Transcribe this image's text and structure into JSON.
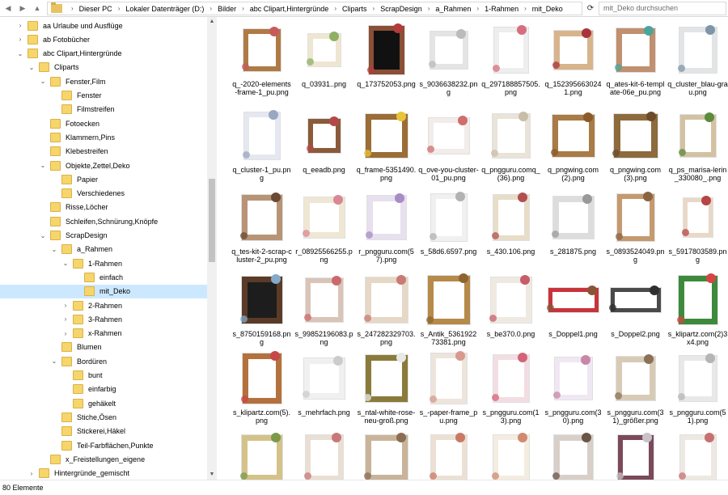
{
  "address": {
    "crumbs": [
      "Dieser PC",
      "Lokaler Datenträger (D:)",
      "Bilder",
      "abc Clipart,Hintergründe",
      "Cliparts",
      "ScrapDesign",
      "a_Rahmen",
      "1-Rahmen",
      "mit_Deko"
    ],
    "search_placeholder": "mit_Deko durchsuchen"
  },
  "tree": [
    {
      "label": "aa Urlaube und Ausflüge",
      "level": 0,
      "expand": "collapsed"
    },
    {
      "label": "ab Fotobücher",
      "level": 0,
      "expand": "collapsed"
    },
    {
      "label": "abc Clipart,Hintergründe",
      "level": 0,
      "expand": "expanded"
    },
    {
      "label": "Cliparts",
      "level": 1,
      "expand": "expanded"
    },
    {
      "label": "Fenster,Film",
      "level": 2,
      "expand": "expanded"
    },
    {
      "label": "Fenster",
      "level": 3,
      "expand": "none"
    },
    {
      "label": "Filmstreifen",
      "level": 3,
      "expand": "none"
    },
    {
      "label": "Fotoecken",
      "level": 2,
      "expand": "none"
    },
    {
      "label": "Klammern,Pins",
      "level": 2,
      "expand": "none"
    },
    {
      "label": "Klebestreifen",
      "level": 2,
      "expand": "none"
    },
    {
      "label": "Objekte,Zettel,Deko",
      "level": 2,
      "expand": "expanded"
    },
    {
      "label": "Papier",
      "level": 3,
      "expand": "none"
    },
    {
      "label": "Verschiedenes",
      "level": 3,
      "expand": "none"
    },
    {
      "label": "Risse,Löcher",
      "level": 2,
      "expand": "none"
    },
    {
      "label": "Schleifen,Schnürung,Knöpfe",
      "level": 2,
      "expand": "none"
    },
    {
      "label": "ScrapDesign",
      "level": 2,
      "expand": "expanded"
    },
    {
      "label": "a_Rahmen",
      "level": 3,
      "expand": "expanded"
    },
    {
      "label": "1-Rahmen",
      "level": 4,
      "expand": "expanded"
    },
    {
      "label": "einfach",
      "level": 5,
      "expand": "none"
    },
    {
      "label": "mit_Deko",
      "level": 5,
      "expand": "none",
      "selected": true
    },
    {
      "label": "2-Rahmen",
      "level": 4,
      "expand": "collapsed"
    },
    {
      "label": "3-Rahmen",
      "level": 4,
      "expand": "collapsed"
    },
    {
      "label": "x-Rahmen",
      "level": 4,
      "expand": "collapsed"
    },
    {
      "label": "Blumen",
      "level": 3,
      "expand": "none"
    },
    {
      "label": "Bordüren",
      "level": 3,
      "expand": "expanded"
    },
    {
      "label": "bunt",
      "level": 4,
      "expand": "none"
    },
    {
      "label": "einfarbig",
      "level": 4,
      "expand": "none"
    },
    {
      "label": "gehäkelt",
      "level": 4,
      "expand": "none"
    },
    {
      "label": "Stiche,Ösen",
      "level": 3,
      "expand": "none"
    },
    {
      "label": "Stickerei,Häkel",
      "level": 3,
      "expand": "none"
    },
    {
      "label": "Teil-Farbflächen,Punkte",
      "level": 3,
      "expand": "none"
    },
    {
      "label": "x_Freistellungen_eigene",
      "level": 2,
      "expand": "none"
    },
    {
      "label": "Hintergründe_gemischt",
      "level": 1,
      "expand": "collapsed"
    }
  ],
  "files": [
    {
      "name": "q_-2020-elements-frame-1_pu.png",
      "frame": "#b07a45",
      "deco": "#c75b5b",
      "w": 46,
      "h": 52,
      "bg": "#ffffff"
    },
    {
      "name": "q_03931..png",
      "frame": "#efe6d2",
      "deco": "#8fb062",
      "w": 40,
      "h": 40,
      "bg": "#ffffff"
    },
    {
      "name": "q_173752053.png",
      "frame": "#8a4f36",
      "deco": "#b43b3b",
      "w": 44,
      "h": 60,
      "bg": "#111111"
    },
    {
      "name": "s_9036638232.png",
      "frame": "#e4e4e4",
      "deco": "#bbbbbb",
      "w": 46,
      "h": 46,
      "bg": "#ffffff"
    },
    {
      "name": "q_297188857505.png",
      "frame": "#eeeeee",
      "deco": "#d56f7d",
      "w": 42,
      "h": 56,
      "bg": "#ffffff"
    },
    {
      "name": "q_1523956630241.png",
      "frame": "#d8b48c",
      "deco": "#a8333b",
      "w": 48,
      "h": 48,
      "bg": "#ffffff"
    },
    {
      "name": "q_ates-kit-6-template-06e_pu.png",
      "frame": "#c09070",
      "deco": "#4aa59c",
      "w": 48,
      "h": 54,
      "bg": "#ffffff"
    },
    {
      "name": "q_cluster_blau-grau.png",
      "frame": "#e2e4e6",
      "deco": "#7f95a8",
      "w": 46,
      "h": 56,
      "bg": "#ffffff"
    },
    {
      "name": "q_cluster-1_pu.png",
      "frame": "#e5e8f0",
      "deco": "#9aa7c0",
      "w": 44,
      "h": 58,
      "bg": "#ffffff"
    },
    {
      "name": "q_eeadb.png",
      "frame": "#8a5a3a",
      "deco": "#b44848",
      "w": 40,
      "h": 42,
      "bg": "#ffffff"
    },
    {
      "name": "q_frame-5351490.png",
      "frame": "#9b6d37",
      "deco": "#e8c43a",
      "w": 52,
      "h": 54,
      "bg": "#ffffff"
    },
    {
      "name": "q_ove-you-cluster-01_pu.png",
      "frame": "#f2ecea",
      "deco": "#d06d6d",
      "w": 50,
      "h": 44,
      "bg": "#ffffff"
    },
    {
      "name": "q_pngguru.comq_(36).png",
      "frame": "#e9e3d8",
      "deco": "#c8bda8",
      "w": 46,
      "h": 54,
      "bg": "#ffffff"
    },
    {
      "name": "q_pngwing.com(2).png",
      "frame": "#a97b46",
      "deco": "#8a5a2a",
      "w": 52,
      "h": 52,
      "bg": "#ffffff"
    },
    {
      "name": "q_pngwing.com(3).png",
      "frame": "#8d6b3d",
      "deco": "#6d4b2a",
      "w": 54,
      "h": 54,
      "bg": "#ffffff"
    },
    {
      "name": "q_ps_marisa-lerin_330080_.png",
      "frame": "#d3c2a2",
      "deco": "#5d8a3e",
      "w": 44,
      "h": 52,
      "bg": "#ffffff"
    },
    {
      "name": "q_tes-kit-2-scrap-cluster-2_pu.png",
      "frame": "#b89477",
      "deco": "#6a4a35",
      "w": 50,
      "h": 56,
      "bg": "#ffffff"
    },
    {
      "name": "r_08925566255.png",
      "frame": "#efe7d3",
      "deco": "#d98794",
      "w": 50,
      "h": 50,
      "bg": "#ffffff"
    },
    {
      "name": "r_pngguru.com(57).png",
      "frame": "#e7e0ee",
      "deco": "#a88cc6",
      "w": 48,
      "h": 54,
      "bg": "#ffffff"
    },
    {
      "name": "s_58d6.6597.png",
      "frame": "#f0f0f0",
      "deco": "#b2b2b2",
      "w": 44,
      "h": 58,
      "bg": "#ffffff"
    },
    {
      "name": "s_430.106.png",
      "frame": "#e7ddc8",
      "deco": "#b25050",
      "w": 44,
      "h": 56,
      "bg": "#ffffff"
    },
    {
      "name": "s_281875.png",
      "frame": "#dddddd",
      "deco": "#999999",
      "w": 50,
      "h": 52,
      "bg": "#ffffff"
    },
    {
      "name": "s_0893524049.png",
      "frame": "#c59a6f",
      "deco": "#8a6542",
      "w": 46,
      "h": 58,
      "bg": "#ffffff"
    },
    {
      "name": "s_5917803589.png",
      "frame": "#e9d8c8",
      "deco": "#b64545",
      "w": 36,
      "h": 48,
      "bg": "#ffffff"
    },
    {
      "name": "s_8750159168.png",
      "frame": "#5a3b28",
      "deco": "#84a9c9",
      "w": 50,
      "h": 58,
      "bg": "#1d1d1d"
    },
    {
      "name": "s_99852196083.png",
      "frame": "#d9c4b8",
      "deco": "#cb6a6a",
      "w": 46,
      "h": 54,
      "bg": "#ffffff"
    },
    {
      "name": "s_247282329703.png",
      "frame": "#e6d7c6",
      "deco": "#c97a74",
      "w": 52,
      "h": 56,
      "bg": "#ffffff"
    },
    {
      "name": "s_Antik_5361922 73381.png",
      "frame": "#b58a4a",
      "deco": "#8d6530",
      "w": 52,
      "h": 60,
      "bg": "#ffffff"
    },
    {
      "name": "s_be370.0.png",
      "frame": "#eeeae2",
      "deco": "#c85d6a",
      "w": 50,
      "h": 56,
      "bg": "#ffffff"
    },
    {
      "name": "s_Doppel1.png",
      "frame": "#c8343b",
      "deco": "#8a5535",
      "w": 62,
      "h": 30,
      "bg": "#ffffff"
    },
    {
      "name": "s_Doppel2.png",
      "frame": "#4a4a4a",
      "deco": "#2f2f2f",
      "w": 62,
      "h": 30,
      "bg": "#ffffff"
    },
    {
      "name": "s_klipartz.com(2)3x4.png",
      "frame": "#3d8a3d",
      "deco": "#d84444",
      "w": 48,
      "h": 60,
      "bg": "#ffffff"
    },
    {
      "name": "s_klipartz.com(5).png",
      "frame": "#b5713d",
      "deco": "#c84848",
      "w": 48,
      "h": 62,
      "bg": "#ffffff"
    },
    {
      "name": "s_mehrfach.png",
      "frame": "#f0f0f0",
      "deco": "#cccccc",
      "w": 50,
      "h": 50,
      "bg": "#ffffff"
    },
    {
      "name": "s_ntal-white-rose-neu-groß.png",
      "frame": "#8a7b3c",
      "deco": "#e8e8e8",
      "w": 52,
      "h": 58,
      "bg": "#ffffff"
    },
    {
      "name": "s_-paper-frame_pu.png",
      "frame": "#ede4dc",
      "deco": "#d69a8e",
      "w": 44,
      "h": 62,
      "bg": "#ffffff"
    },
    {
      "name": "s_pngguru.com(13).png",
      "frame": "#f2dde2",
      "deco": "#d4637a",
      "w": 44,
      "h": 58,
      "bg": "#ffffff"
    },
    {
      "name": "s_pngguru.com(30).png",
      "frame": "#efe8f2",
      "deco": "#c887a8",
      "w": 46,
      "h": 52,
      "bg": "#ffffff"
    },
    {
      "name": "s_pngguru.com(31)_größer.png",
      "frame": "#d8cbb6",
      "deco": "#8a7158",
      "w": 48,
      "h": 54,
      "bg": "#ffffff"
    },
    {
      "name": "s_pngguru.com(51).png",
      "frame": "#e8e8e8",
      "deco": "#b5b5b5",
      "w": 46,
      "h": 56,
      "bg": "#ffffff"
    },
    {
      "name": "",
      "frame": "#d4c28a",
      "deco": "#7a9a4a",
      "w": 50,
      "h": 56,
      "bg": "#ffffff"
    },
    {
      "name": "",
      "frame": "#e9dfd2",
      "deco": "#c8787a",
      "w": 46,
      "h": 56,
      "bg": "#ffffff"
    },
    {
      "name": "",
      "frame": "#c9b49a",
      "deco": "#8a6d52",
      "w": 52,
      "h": 56,
      "bg": "#ffffff"
    },
    {
      "name": "",
      "frame": "#ece0d4",
      "deco": "#c97a66",
      "w": 44,
      "h": 56,
      "bg": "#ffffff"
    },
    {
      "name": "",
      "frame": "#f4ece0",
      "deco": "#d08a70",
      "w": 44,
      "h": 56,
      "bg": "#ffffff"
    },
    {
      "name": "",
      "frame": "#d8cfc8",
      "deco": "#6b5548",
      "w": 48,
      "h": 56,
      "bg": "#ffffff"
    },
    {
      "name": "",
      "frame": "#7b4a5a",
      "deco": "#c8c2c8",
      "w": 44,
      "h": 56,
      "bg": "#ffffff"
    },
    {
      "name": "",
      "frame": "#ede8e2",
      "deco": "#c87070",
      "w": 44,
      "h": 56,
      "bg": "#ffffff"
    }
  ],
  "status": {
    "count": "80 Elemente"
  }
}
